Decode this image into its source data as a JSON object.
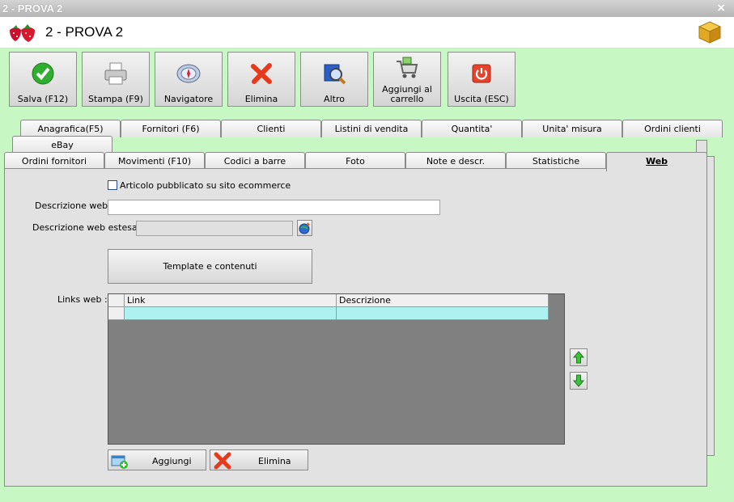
{
  "window": {
    "title": "2 - PROVA 2",
    "close_glyph": "×"
  },
  "header": {
    "title": "2 - PROVA 2",
    "logo_icon": "strawberry-icon",
    "right_icon": "package-icon"
  },
  "toolbar": {
    "buttons": [
      {
        "label": "Salva (F12)",
        "icon": "check-icon"
      },
      {
        "label": "Stampa (F9)",
        "icon": "printer-icon"
      },
      {
        "label": "Navigatore",
        "icon": "compass-icon"
      },
      {
        "label": "Elimina",
        "icon": "delete-x-icon"
      },
      {
        "label": "Altro",
        "icon": "search-book-icon"
      },
      {
        "label": "Aggiungi al carrello",
        "icon": "cart-icon"
      },
      {
        "label": "Uscita (ESC)",
        "icon": "power-icon"
      }
    ]
  },
  "tabs": {
    "row1": [
      "Anagrafica(F5)",
      "Fornitori (F6)",
      "Clienti",
      "Listini di vendita",
      "Quantita'",
      "Unita' misura",
      "Ordini clienti"
    ],
    "row2": [
      "eBay"
    ],
    "row3": [
      "Ordini fornitori",
      "Movimenti (F10)",
      "Codici a barre",
      "Foto",
      "Note e descr.",
      "Statistiche",
      "Web"
    ],
    "active": "Web"
  },
  "form": {
    "published_checkbox": {
      "label": "Articolo pubblicato su sito ecommerce",
      "checked": false
    },
    "descrizione_web": {
      "label": "Descrizione web :",
      "value": ""
    },
    "descrizione_web_estesa": {
      "label": "Descrizione web estesa :",
      "value": ""
    },
    "template_button": "Template e contenuti",
    "links_label": "Links web :",
    "grid": {
      "columns": [
        "Link",
        "Descrizione"
      ],
      "rows": [
        [
          "",
          ""
        ]
      ]
    },
    "add_button": "Aggiungi",
    "delete_button": "Elimina"
  },
  "colors": {
    "background": "#c7f7c2",
    "panel": "#e2e2e2",
    "grid_bg": "#808080",
    "selected_row": "#aef1f1"
  }
}
